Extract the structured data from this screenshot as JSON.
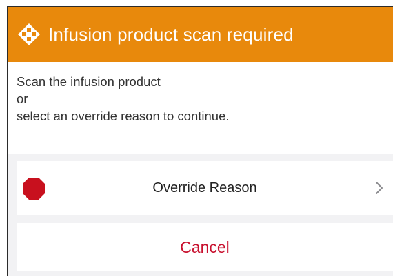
{
  "dialog": {
    "title": "Infusion product scan required",
    "icon": "diamond-scan-icon",
    "header_color": "#E8890C",
    "message_lines": [
      "Scan the infusion product",
      "or",
      "select an override reason to continue."
    ]
  },
  "options": {
    "override": {
      "label": "Override Reason",
      "icon": "stop-sign-icon",
      "icon_color": "#C8101E",
      "chevron_icon": "chevron-right-icon"
    },
    "cancel": {
      "label": "Cancel",
      "color": "#C8102E"
    }
  }
}
